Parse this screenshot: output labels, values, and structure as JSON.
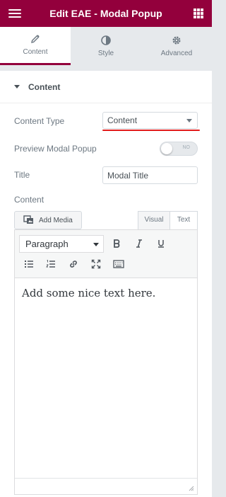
{
  "header": {
    "title": "Edit EAE - Modal Popup"
  },
  "tabs": [
    {
      "label": "Content"
    },
    {
      "label": "Style"
    },
    {
      "label": "Advanced"
    }
  ],
  "section": {
    "title": "Content"
  },
  "fields": {
    "content_type": {
      "label": "Content Type",
      "value": "Content"
    },
    "preview": {
      "label": "Preview Modal Popup",
      "toggle_text": "NO"
    },
    "title": {
      "label": "Title",
      "value": "Modal Title"
    },
    "content": {
      "label": "Content"
    }
  },
  "editor": {
    "add_media_label": "Add Media",
    "visual_tab": "Visual",
    "text_tab": "Text",
    "format_value": "Paragraph",
    "body_text": "Add some nice text here."
  },
  "colors": {
    "brand": "#93003c",
    "highlight": "#e21b1b"
  }
}
